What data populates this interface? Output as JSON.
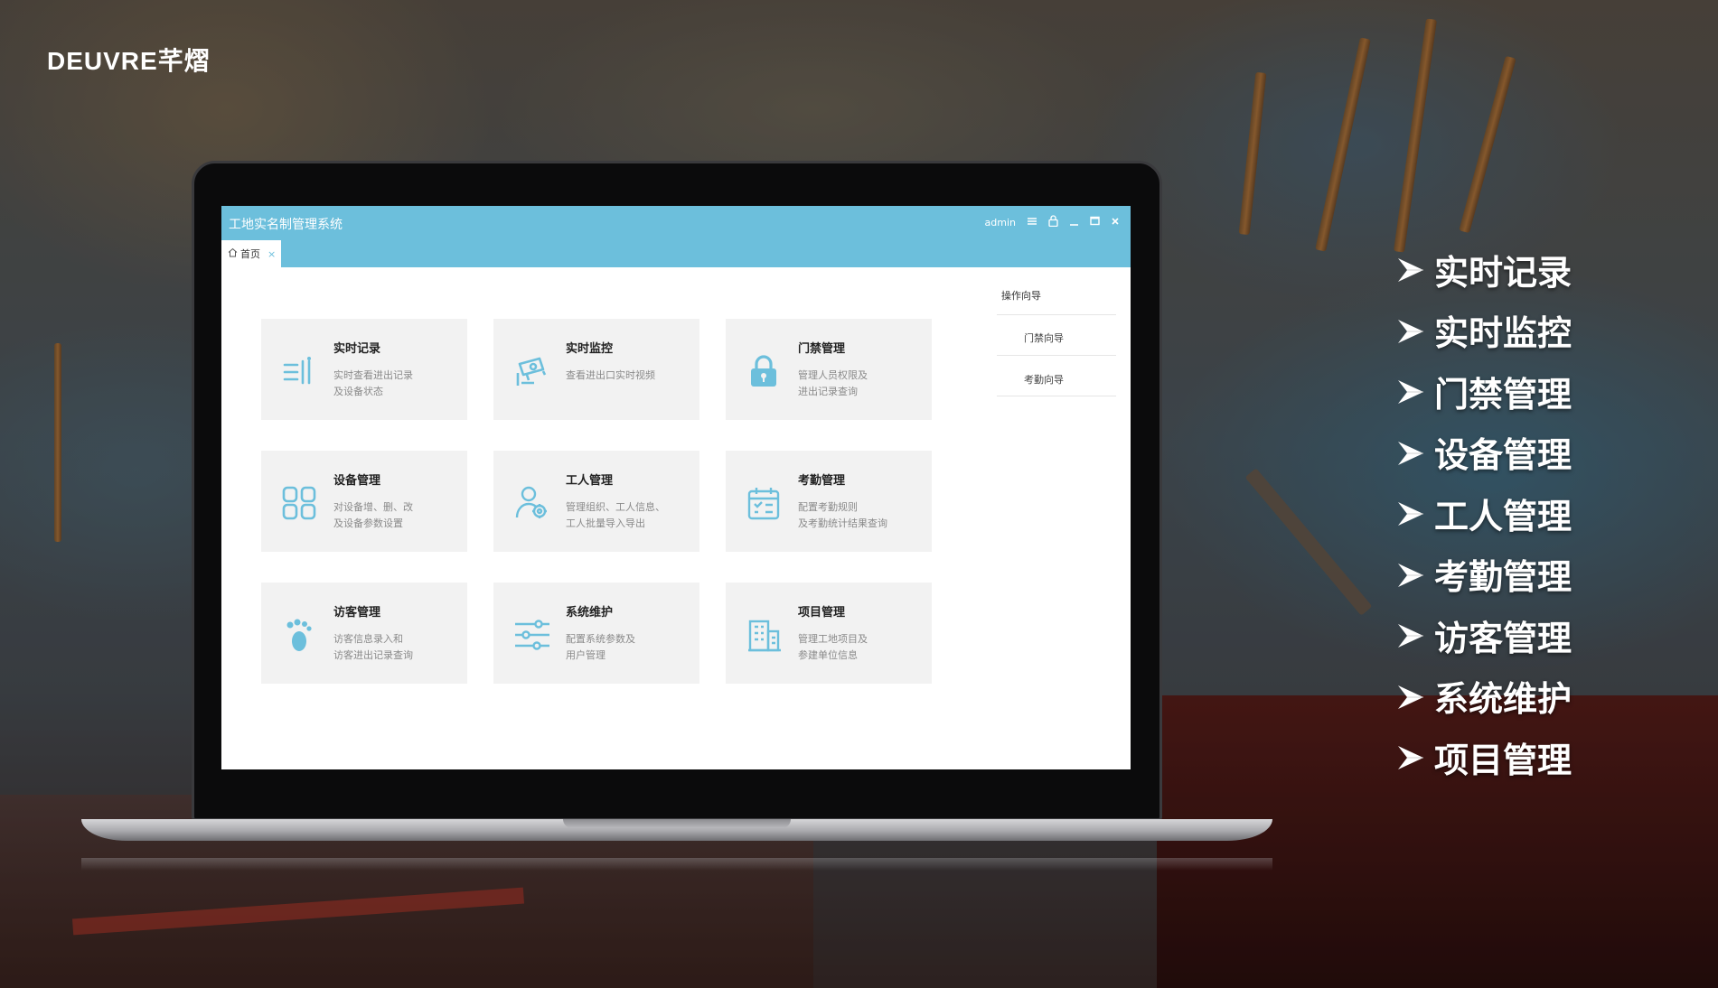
{
  "brand": {
    "logo_text": "DEUVRE芊熠"
  },
  "app": {
    "title": "工地实名制管理系统",
    "user": "admin",
    "controls": {
      "menu_icon": "menu-lines-icon",
      "lock_icon": "lock-icon",
      "minimize_icon": "minimize-icon",
      "maximize_icon": "maximize-icon",
      "close_icon": "close-icon"
    },
    "tab": {
      "label": "首页",
      "close": "×"
    },
    "cards": [
      {
        "title": "实时记录",
        "desc": "实时查看进出记录\n及设备状态",
        "icon": "records-list-icon"
      },
      {
        "title": "实时监控",
        "desc": "查看进出口实时视频",
        "icon": "camera-icon"
      },
      {
        "title": "门禁管理",
        "desc": "管理人员权限及\n进出记录查询",
        "icon": "padlock-icon"
      },
      {
        "title": "设备管理",
        "desc": "对设备增、删、改\n及设备参数设置",
        "icon": "grid-icon"
      },
      {
        "title": "工人管理",
        "desc": "管理组织、工人信息、\n工人批量导入导出",
        "icon": "worker-gear-icon"
      },
      {
        "title": "考勤管理",
        "desc": "配置考勤规则\n及考勤统计结果查询",
        "icon": "calendar-icon"
      },
      {
        "title": "访客管理",
        "desc": "访客信息录入和\n访客进出记录查询",
        "icon": "footprint-icon"
      },
      {
        "title": "系统维护",
        "desc": "配置系统参数及\n用户管理",
        "icon": "sliders-icon"
      },
      {
        "title": "项目管理",
        "desc": "管理工地项目及\n参建单位信息",
        "icon": "building-icon"
      }
    ],
    "guide": {
      "title": "操作向导",
      "items": [
        "门禁向导",
        "考勤向导"
      ]
    }
  },
  "features": [
    "实时记录",
    "实时监控",
    "门禁管理",
    "设备管理",
    "工人管理",
    "考勤管理",
    "访客管理",
    "系统维护",
    "项目管理"
  ],
  "colors": {
    "accent": "#6cbfdc",
    "card_bg": "#f2f2f2",
    "icon": "#6cbfdc"
  }
}
